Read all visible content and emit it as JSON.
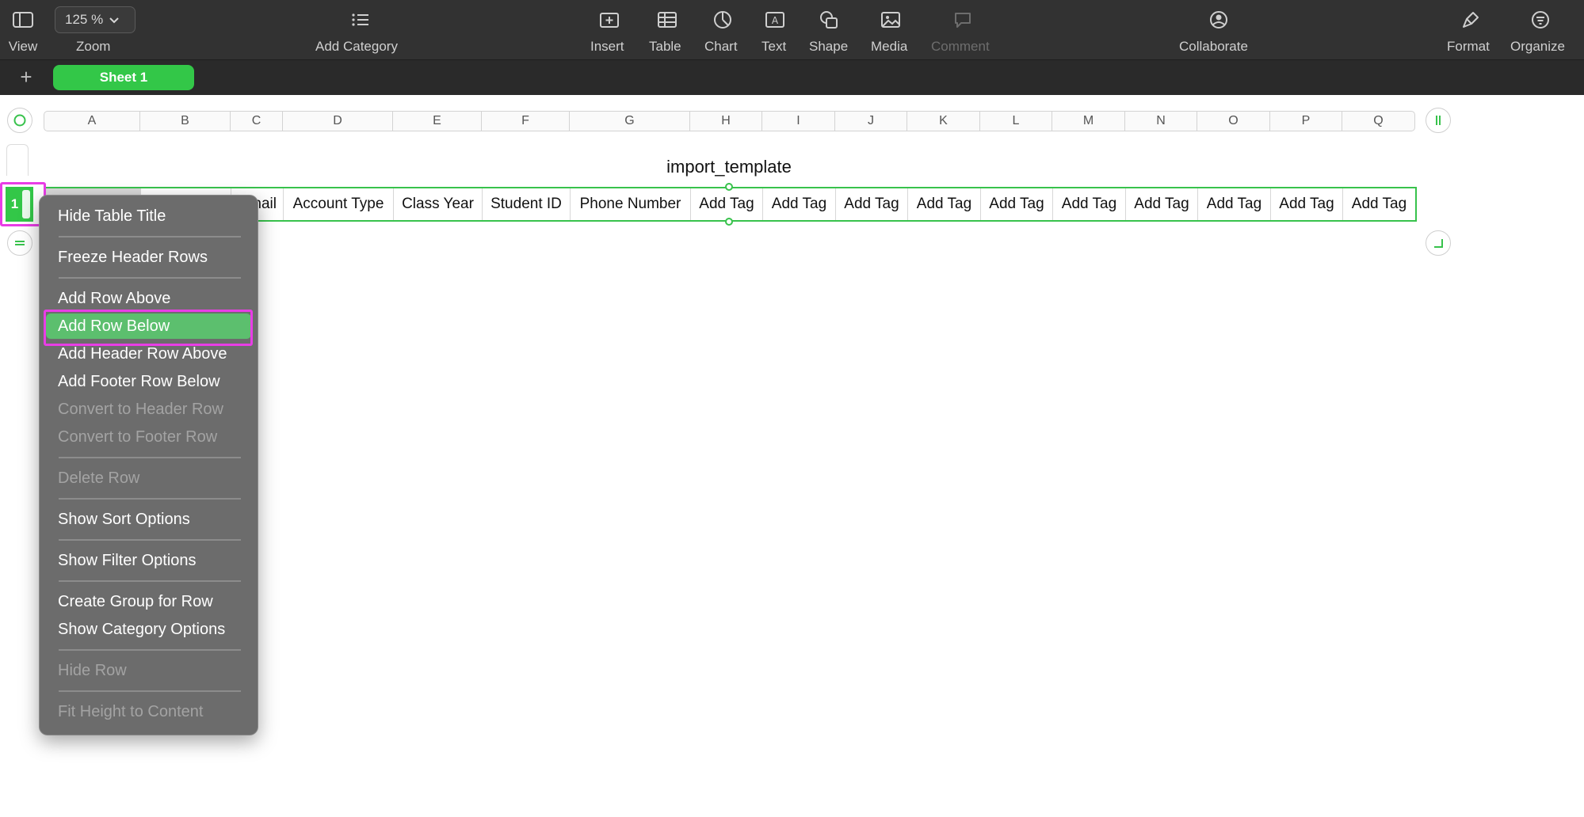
{
  "toolbar": {
    "view_label": "View",
    "zoom_value": "125 %",
    "zoom_label": "Zoom",
    "add_category_label": "Add Category",
    "insert_label": "Insert",
    "table_label": "Table",
    "chart_label": "Chart",
    "text_label": "Text",
    "shape_label": "Shape",
    "media_label": "Media",
    "comment_label": "Comment",
    "collaborate_label": "Collaborate",
    "format_label": "Format",
    "organize_label": "Organize"
  },
  "tabs": {
    "add_icon": "+",
    "sheets": [
      {
        "label": "Sheet 1",
        "active": true
      }
    ]
  },
  "sheet": {
    "columns": [
      "A",
      "B",
      "C",
      "D",
      "E",
      "F",
      "G",
      "H",
      "I",
      "J",
      "K",
      "L",
      "M",
      "N",
      "O",
      "P",
      "Q"
    ],
    "table_title": "import_template",
    "row_number": "1",
    "header_cells": [
      "",
      "",
      "nail",
      "Account Type",
      "Class Year",
      "Student ID",
      "Phone Number",
      "Add Tag",
      "Add Tag",
      "Add Tag",
      "Add Tag",
      "Add Tag",
      "Add Tag",
      "Add Tag",
      "Add Tag",
      "Add Tag",
      "Add Tag"
    ]
  },
  "context_menu": {
    "items": [
      {
        "label": "Hide Table Title",
        "enabled": true
      },
      {
        "label": "Freeze Header Rows",
        "enabled": true
      },
      {
        "label": "Add Row Above",
        "enabled": true
      },
      {
        "label": "Add Row Below",
        "enabled": true,
        "selected": true
      },
      {
        "label": "Add Header Row Above",
        "enabled": true
      },
      {
        "label": "Add Footer Row Below",
        "enabled": true
      },
      {
        "label": "Convert to Header Row",
        "enabled": false
      },
      {
        "label": "Convert to Footer Row",
        "enabled": false
      },
      {
        "label": "Delete Row",
        "enabled": false
      },
      {
        "label": "Show Sort Options",
        "enabled": true
      },
      {
        "label": "Show Filter Options",
        "enabled": true
      },
      {
        "label": "Create Group for Row",
        "enabled": true
      },
      {
        "label": "Show Category Options",
        "enabled": true
      },
      {
        "label": "Hide Row",
        "enabled": false
      },
      {
        "label": "Fit Height to Content",
        "enabled": false
      }
    ]
  },
  "colors": {
    "accent_green": "#33c748",
    "highlight_magenta": "#e93de6",
    "menu_selected": "#5cbf6e",
    "toolbar_bg": "#323232"
  }
}
